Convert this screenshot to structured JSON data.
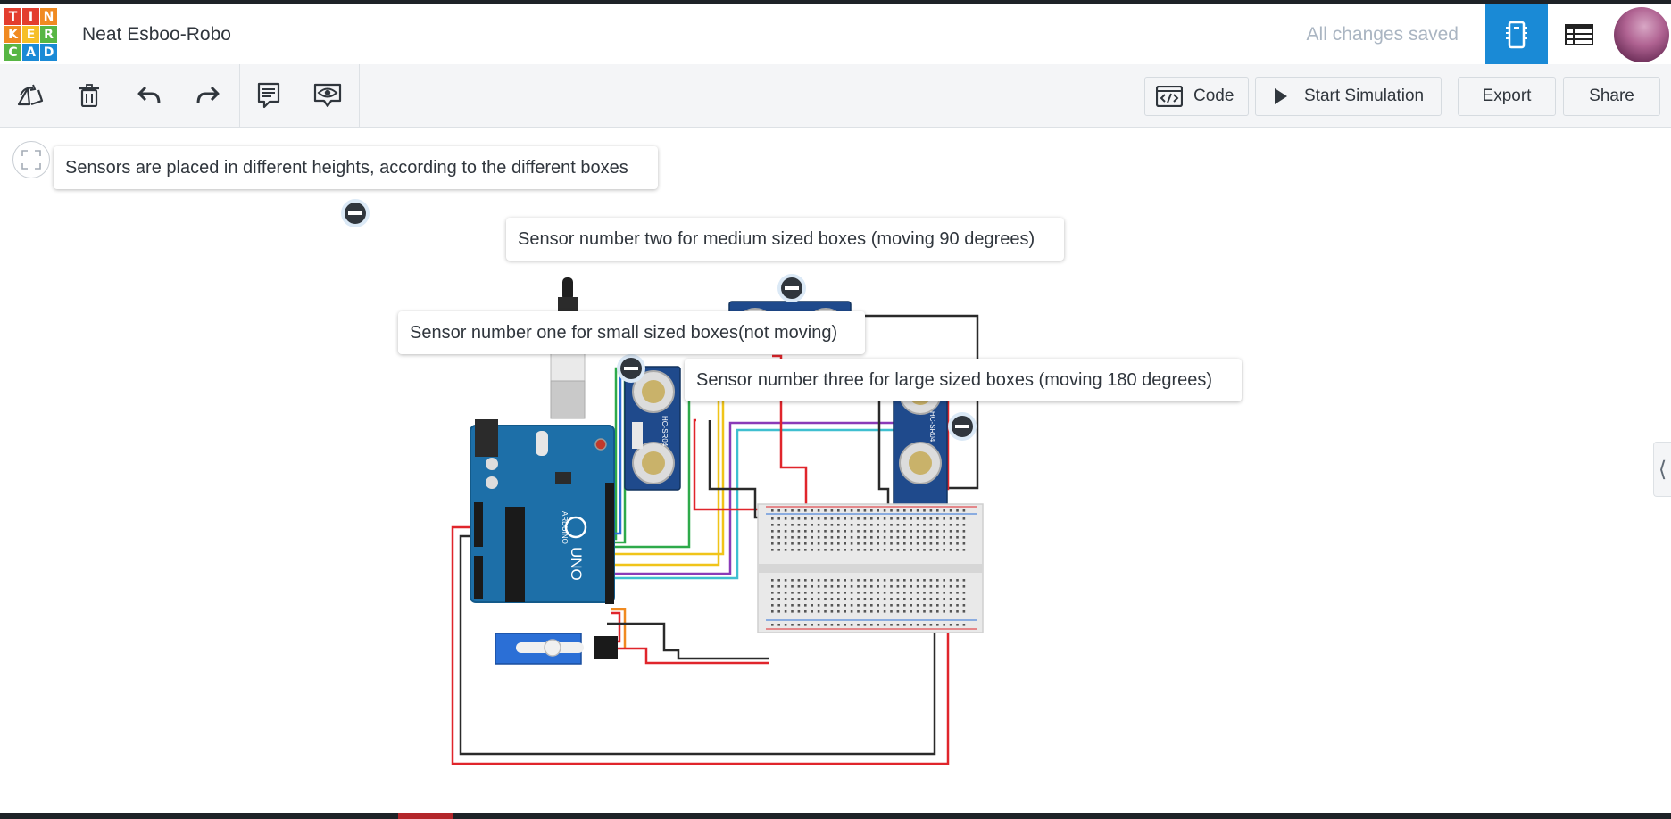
{
  "header": {
    "logo_letters": [
      "T",
      "I",
      "N",
      "K",
      "E",
      "R",
      "C",
      "A",
      "D"
    ],
    "logo_colors": [
      "#e33d2e",
      "#e33d2e",
      "#f08a21",
      "#f08a21",
      "#f6bf26",
      "#58b644",
      "#58b644",
      "#1a8ad6",
      "#1a8ad6"
    ],
    "title": "Neat Esboo-Robo",
    "save_status": "All changes saved",
    "view_buttons": [
      {
        "name": "circuit-view-icon",
        "active": true
      },
      {
        "name": "component-list-icon",
        "active": false
      }
    ],
    "accent_color": "#1a8ad6"
  },
  "toolbar": {
    "tools": [
      "rotate-icon",
      "delete-icon",
      "undo-icon",
      "redo-icon",
      "notes-icon",
      "notes-visibility-icon"
    ],
    "code_label": "Code",
    "start_simulation_label": "Start Simulation",
    "export_label": "Export",
    "share_label": "Share"
  },
  "canvas": {
    "notes": [
      {
        "text": "Sensors are placed in different heights, according to the different boxes"
      },
      {
        "text": "Sensor number two for medium sized boxes (moving 90 degrees)"
      },
      {
        "text": "Sensor number one for small sized boxes(not moving)"
      },
      {
        "text": "Sensor number three for large sized boxes (moving 180 degrees)"
      }
    ],
    "components": [
      "Arduino UNO",
      "HC-SR04",
      "HC-SR04",
      "HC-SR04",
      "micro servo",
      "breadboard"
    ],
    "board_label": "UNO",
    "board_brand": "ARDUINO",
    "sensor_label": "HC-SR04",
    "wire_colors": {
      "red": "#e0252b",
      "black": "#2a2a2a",
      "yellow": "#f0c419",
      "purple": "#8a3ab8",
      "cyan": "#3fbfd0",
      "green": "#2eaa4a",
      "orange": "#f08a21",
      "blue": "#2b6fd6"
    }
  }
}
